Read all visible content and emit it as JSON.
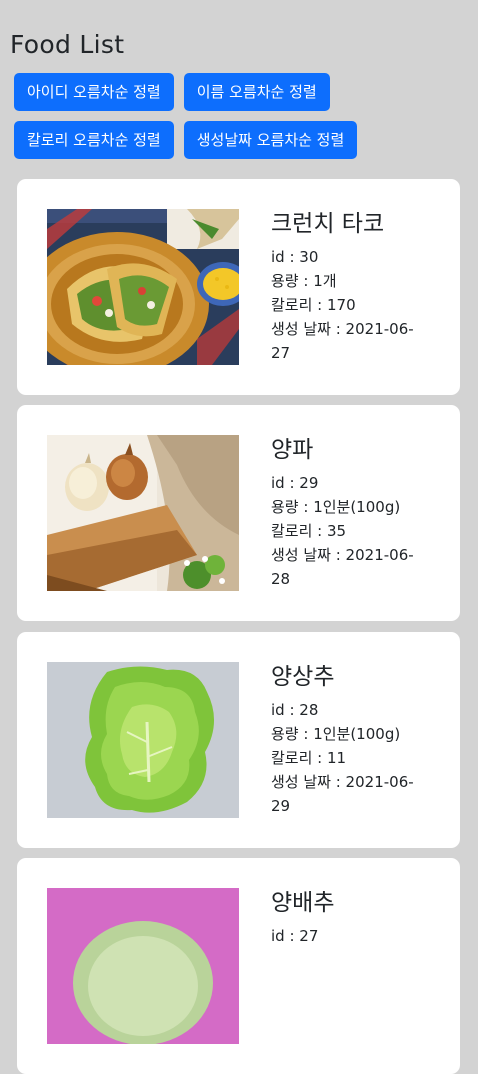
{
  "page": {
    "title": "Food List"
  },
  "sort_buttons": [
    "아이디 오름차순 정렬",
    "이름 오름차순 정렬",
    "칼로리 오름차순 정렬",
    "생성날짜 오름차순 정렬"
  ],
  "foods": [
    {
      "name": "크런치 타코",
      "id_line": "id : 30",
      "amount_line": "용량 : 1개",
      "calorie_line": "칼로리 : 170",
      "date_line_1": "생성 날짜 : 2021-06-",
      "date_line_2": "27",
      "image": "taco-photo"
    },
    {
      "name": "양파",
      "id_line": "id : 29",
      "amount_line": "용량 : 1인분(100g)",
      "calorie_line": "칼로리 : 35",
      "date_line_1": "생성 날짜 : 2021-06-",
      "date_line_2": "28",
      "image": "onion-photo"
    },
    {
      "name": "양상추",
      "id_line": "id : 28",
      "amount_line": "용량 : 1인분(100g)",
      "calorie_line": "칼로리 : 11",
      "date_line_1": "생성 날짜 : 2021-06-",
      "date_line_2": "29",
      "image": "lettuce-photo"
    },
    {
      "name": "양배추",
      "id_line": "id : 27",
      "image": "cabbage-photo"
    }
  ],
  "colors": {
    "background": "#d3d3d3",
    "button": "#0d6efd",
    "card": "#ffffff",
    "text": "#212529"
  }
}
